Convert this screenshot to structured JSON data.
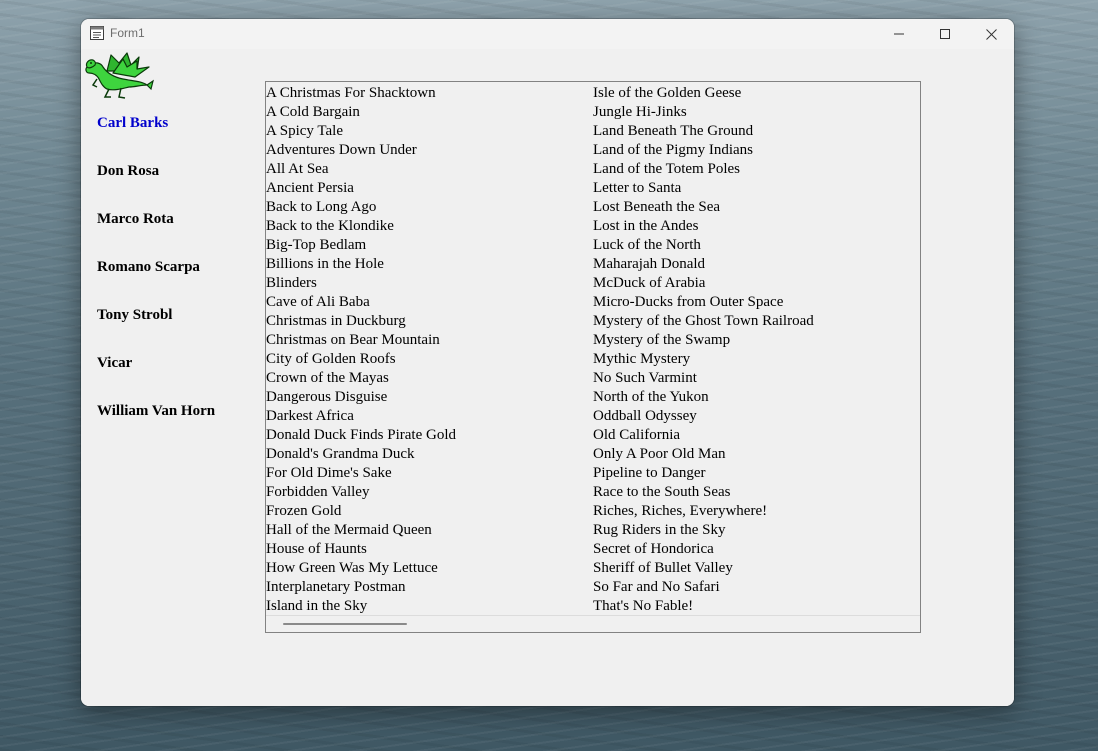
{
  "window": {
    "title": "Form1"
  },
  "authors": [
    {
      "name": "Carl Barks",
      "selected": true
    },
    {
      "name": "Don Rosa",
      "selected": false
    },
    {
      "name": "Marco Rota",
      "selected": false
    },
    {
      "name": "Romano Scarpa",
      "selected": false
    },
    {
      "name": "Tony Strobl",
      "selected": false
    },
    {
      "name": "Vicar",
      "selected": false
    },
    {
      "name": "William Van Horn",
      "selected": false
    }
  ],
  "stories": {
    "column1": [
      "A Christmas For Shacktown",
      "A Cold Bargain",
      "A Spicy Tale",
      "Adventures Down Under",
      "All At Sea",
      "Ancient Persia",
      "Back to Long Ago",
      "Back to the Klondike",
      "Big-Top Bedlam",
      "Billions in the Hole",
      "Blinders",
      "Cave of Ali Baba",
      "Christmas in Duckburg",
      "Christmas on Bear Mountain",
      "City of Golden Roofs",
      "Crown of the Mayas",
      "Dangerous Disguise",
      "Darkest Africa",
      "Donald Duck Finds Pirate Gold",
      "Donald's Grandma Duck",
      "For Old Dime's Sake",
      "Forbidden Valley",
      "Frozen Gold",
      "Hall of the Mermaid Queen",
      "House of Haunts",
      "How Green Was My Lettuce",
      "Interplanetary Postman",
      "Island in the Sky"
    ],
    "column2": [
      "Isle of the Golden Geese",
      "Jungle Hi-Jinks",
      "Land Beneath The Ground",
      "Land of the Pigmy Indians",
      "Land of the Totem Poles",
      "Letter to Santa",
      "Lost Beneath the Sea",
      "Lost in the Andes",
      "Luck of the North",
      "Maharajah Donald",
      "McDuck of Arabia",
      "Micro-Ducks from Outer Space",
      "Mystery of the Ghost Town Railroad",
      "Mystery of the Swamp",
      "Mythic Mystery",
      "No Such Varmint",
      "North of the Yukon",
      "Oddball Odyssey",
      "Old California",
      "Only A Poor Old Man",
      "Pipeline to Danger",
      "Race to the South Seas",
      "Riches, Riches, Everywhere!",
      "Rug Riders in the Sky",
      "Secret of Hondorica",
      "Sheriff of Bullet Valley",
      "So Far and No Safari",
      "That's No Fable!"
    ]
  },
  "icons": {
    "app": "form-window-icon",
    "logo": "green-dragon-icon",
    "minimize": "minimize-icon",
    "maximize": "maximize-icon",
    "close": "close-icon"
  },
  "colors": {
    "selected_author": "#0000cc",
    "dragon": "#3ed43e"
  }
}
